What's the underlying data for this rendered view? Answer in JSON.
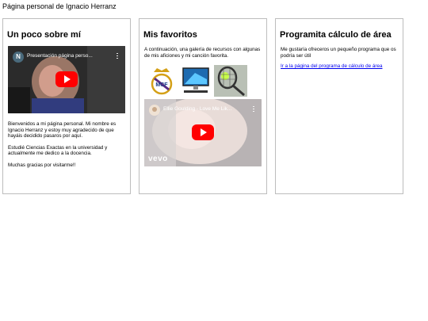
{
  "page": {
    "title": "Página personal de Ignacio Herranz"
  },
  "about": {
    "heading": "Un poco sobre mí",
    "video_title": "Presentación página perso...",
    "video_avatar": "N",
    "paragraph1": "Bienvenidos a mi página personal. Mi nombre es Ignacio Herranz y estoy muy agradecido de que hayáis decidido pasaros por aquí.",
    "paragraph2": "Estudié Ciencias Exactas en la universidad y actualmente me dedico a la docencia.",
    "paragraph3": "Muchas gracias por visitarme!!"
  },
  "favorites": {
    "heading": "Mis favoritos",
    "intro": "A continuación, una galería de recursos con algunas de mis aficiones y mi canción favorita.",
    "gallery": [
      {
        "name": "real-madrid-crest-icon"
      },
      {
        "name": "computer-icon"
      },
      {
        "name": "tennis-racket-icon"
      }
    ],
    "video_title": "Ellie Goulding - Love Me Lik...",
    "video_watermark": "vevo"
  },
  "calculator": {
    "heading": "Programita cálculo de área",
    "intro": "Me gustaría ofreceros un pequeño programa que os podría ser útil",
    "link_label": "Ir a la página del programa de cálculo de área"
  },
  "colors": {
    "youtube_red": "#ff0000",
    "link": "#0000ee",
    "card_border": "#bdbdbd"
  }
}
